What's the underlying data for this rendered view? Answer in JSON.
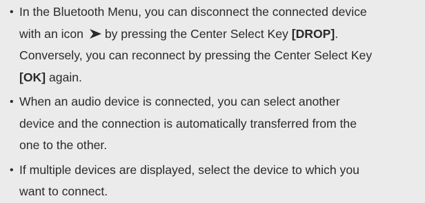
{
  "notes": [
    {
      "l1_before_icon": "In the Bluetooth Menu, you can disconnect the connected device",
      "l2_prefix": "with an icon",
      "icon": "arrow-icon",
      "l2_middle": "by pressing the Center Select Key",
      "l2_key": "[DROP]",
      "l2_end": ".",
      "l3": "Conversely, you can reconnect by pressing the Center Select Key",
      "l4_key": "[OK]",
      "l4_end": "again."
    },
    {
      "l1": "When an audio device is connected, you can select another",
      "l2": "device and the connection is automatically transferred from the",
      "l3": "one to the other."
    },
    {
      "l1": "If multiple devices are displayed, select the device to which you",
      "l2": "want to connect."
    }
  ],
  "bullet_symbol": "•"
}
